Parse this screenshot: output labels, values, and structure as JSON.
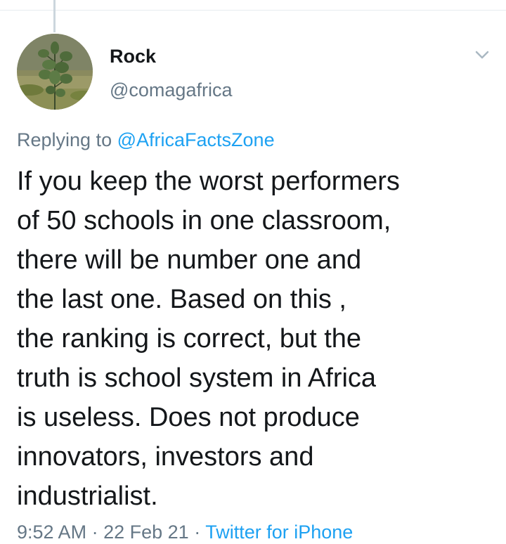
{
  "tweet": {
    "display_name": "Rock",
    "handle": "@comagafrica",
    "avatar_icon": "avatar-plant-photo",
    "menu_icon": "chevron-down-icon",
    "replying_prefix": "Replying to",
    "replying_mention": "@AfricaFactsZone",
    "body_lines": [
      "If you keep the worst performers",
      "of 50 schools in one classroom,",
      "there will be number one and",
      "the last one. Based on this ,",
      "the ranking is correct, but the",
      "truth is school system in Africa",
      "is useless. Does not produce",
      "innovators, investors and",
      "industrialist."
    ],
    "time": "9:52 AM",
    "separator": "·",
    "date": "22 Feb 21",
    "source": "Twitter for iPhone"
  },
  "colors": {
    "text": "#14171a",
    "secondary": "#657786",
    "link": "#1da1f2",
    "divider": "#e6ecf0"
  }
}
